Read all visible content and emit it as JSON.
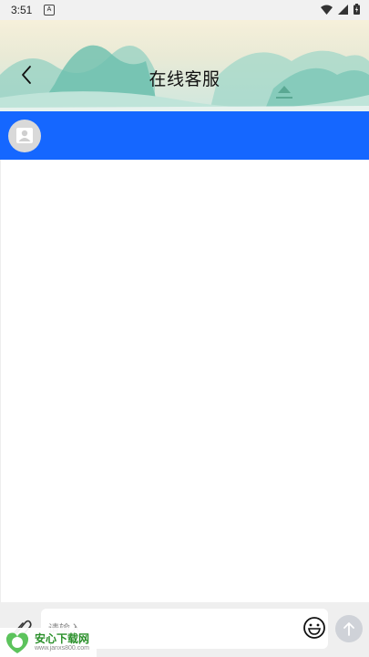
{
  "status_bar": {
    "time": "3:51",
    "notification_icon": "A",
    "icons": [
      "wifi-icon",
      "signal-icon",
      "battery-icon"
    ]
  },
  "header": {
    "title": "在线客服",
    "back_icon": "chevron-left-icon"
  },
  "agent_bar": {
    "color": "#1567ff",
    "avatar_icon": "user-avatar-icon"
  },
  "input_bar": {
    "placeholder": "请输入",
    "attach_icon": "paperclip-icon",
    "emoji_icon": "emoji-icon",
    "send_icon": "arrow-up-icon"
  },
  "watermark": {
    "name": "安心下载网",
    "url": "www.janxs800.com"
  }
}
